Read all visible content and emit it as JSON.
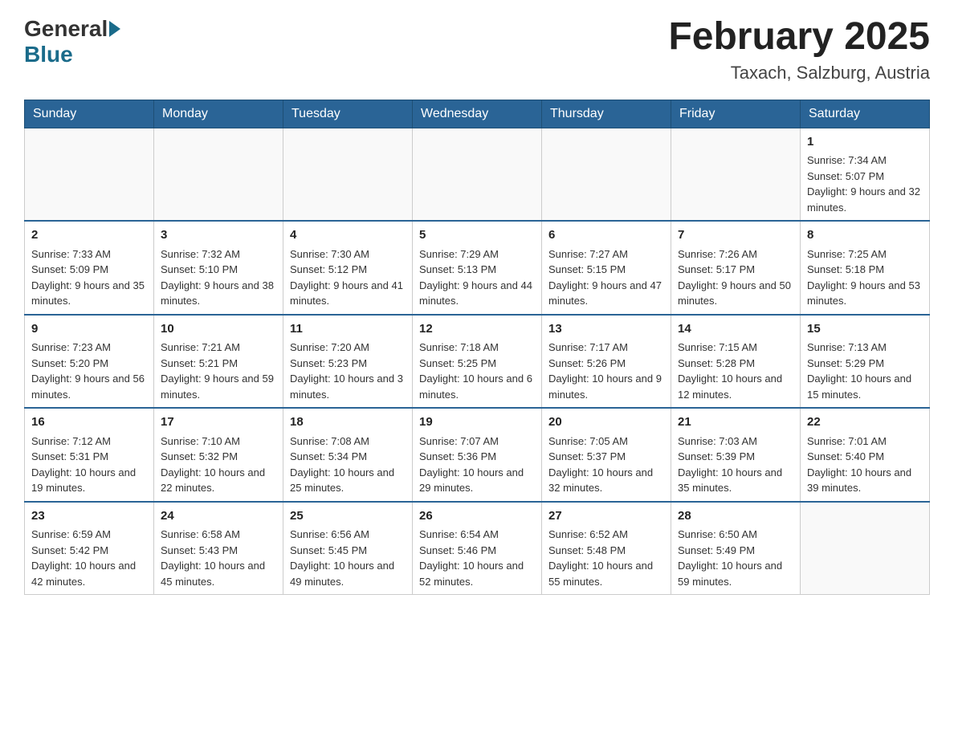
{
  "header": {
    "logo_text_general": "General",
    "logo_text_blue": "Blue",
    "title": "February 2025",
    "subtitle": "Taxach, Salzburg, Austria"
  },
  "days_of_week": [
    "Sunday",
    "Monday",
    "Tuesday",
    "Wednesday",
    "Thursday",
    "Friday",
    "Saturday"
  ],
  "weeks": [
    {
      "days": [
        {
          "num": "",
          "info": ""
        },
        {
          "num": "",
          "info": ""
        },
        {
          "num": "",
          "info": ""
        },
        {
          "num": "",
          "info": ""
        },
        {
          "num": "",
          "info": ""
        },
        {
          "num": "",
          "info": ""
        },
        {
          "num": "1",
          "info": "Sunrise: 7:34 AM\nSunset: 5:07 PM\nDaylight: 9 hours and 32 minutes."
        }
      ]
    },
    {
      "days": [
        {
          "num": "2",
          "info": "Sunrise: 7:33 AM\nSunset: 5:09 PM\nDaylight: 9 hours and 35 minutes."
        },
        {
          "num": "3",
          "info": "Sunrise: 7:32 AM\nSunset: 5:10 PM\nDaylight: 9 hours and 38 minutes."
        },
        {
          "num": "4",
          "info": "Sunrise: 7:30 AM\nSunset: 5:12 PM\nDaylight: 9 hours and 41 minutes."
        },
        {
          "num": "5",
          "info": "Sunrise: 7:29 AM\nSunset: 5:13 PM\nDaylight: 9 hours and 44 minutes."
        },
        {
          "num": "6",
          "info": "Sunrise: 7:27 AM\nSunset: 5:15 PM\nDaylight: 9 hours and 47 minutes."
        },
        {
          "num": "7",
          "info": "Sunrise: 7:26 AM\nSunset: 5:17 PM\nDaylight: 9 hours and 50 minutes."
        },
        {
          "num": "8",
          "info": "Sunrise: 7:25 AM\nSunset: 5:18 PM\nDaylight: 9 hours and 53 minutes."
        }
      ]
    },
    {
      "days": [
        {
          "num": "9",
          "info": "Sunrise: 7:23 AM\nSunset: 5:20 PM\nDaylight: 9 hours and 56 minutes."
        },
        {
          "num": "10",
          "info": "Sunrise: 7:21 AM\nSunset: 5:21 PM\nDaylight: 9 hours and 59 minutes."
        },
        {
          "num": "11",
          "info": "Sunrise: 7:20 AM\nSunset: 5:23 PM\nDaylight: 10 hours and 3 minutes."
        },
        {
          "num": "12",
          "info": "Sunrise: 7:18 AM\nSunset: 5:25 PM\nDaylight: 10 hours and 6 minutes."
        },
        {
          "num": "13",
          "info": "Sunrise: 7:17 AM\nSunset: 5:26 PM\nDaylight: 10 hours and 9 minutes."
        },
        {
          "num": "14",
          "info": "Sunrise: 7:15 AM\nSunset: 5:28 PM\nDaylight: 10 hours and 12 minutes."
        },
        {
          "num": "15",
          "info": "Sunrise: 7:13 AM\nSunset: 5:29 PM\nDaylight: 10 hours and 15 minutes."
        }
      ]
    },
    {
      "days": [
        {
          "num": "16",
          "info": "Sunrise: 7:12 AM\nSunset: 5:31 PM\nDaylight: 10 hours and 19 minutes."
        },
        {
          "num": "17",
          "info": "Sunrise: 7:10 AM\nSunset: 5:32 PM\nDaylight: 10 hours and 22 minutes."
        },
        {
          "num": "18",
          "info": "Sunrise: 7:08 AM\nSunset: 5:34 PM\nDaylight: 10 hours and 25 minutes."
        },
        {
          "num": "19",
          "info": "Sunrise: 7:07 AM\nSunset: 5:36 PM\nDaylight: 10 hours and 29 minutes."
        },
        {
          "num": "20",
          "info": "Sunrise: 7:05 AM\nSunset: 5:37 PM\nDaylight: 10 hours and 32 minutes."
        },
        {
          "num": "21",
          "info": "Sunrise: 7:03 AM\nSunset: 5:39 PM\nDaylight: 10 hours and 35 minutes."
        },
        {
          "num": "22",
          "info": "Sunrise: 7:01 AM\nSunset: 5:40 PM\nDaylight: 10 hours and 39 minutes."
        }
      ]
    },
    {
      "days": [
        {
          "num": "23",
          "info": "Sunrise: 6:59 AM\nSunset: 5:42 PM\nDaylight: 10 hours and 42 minutes."
        },
        {
          "num": "24",
          "info": "Sunrise: 6:58 AM\nSunset: 5:43 PM\nDaylight: 10 hours and 45 minutes."
        },
        {
          "num": "25",
          "info": "Sunrise: 6:56 AM\nSunset: 5:45 PM\nDaylight: 10 hours and 49 minutes."
        },
        {
          "num": "26",
          "info": "Sunrise: 6:54 AM\nSunset: 5:46 PM\nDaylight: 10 hours and 52 minutes."
        },
        {
          "num": "27",
          "info": "Sunrise: 6:52 AM\nSunset: 5:48 PM\nDaylight: 10 hours and 55 minutes."
        },
        {
          "num": "28",
          "info": "Sunrise: 6:50 AM\nSunset: 5:49 PM\nDaylight: 10 hours and 59 minutes."
        },
        {
          "num": "",
          "info": ""
        }
      ]
    }
  ]
}
